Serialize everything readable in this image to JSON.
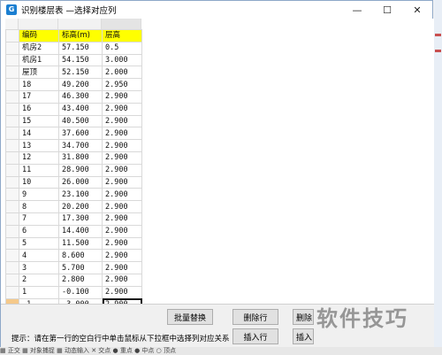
{
  "window": {
    "title": "识别楼层表 —选择对应列",
    "app_icon": "G",
    "minimize_glyph": "—",
    "maximize_glyph": "☐",
    "close_glyph": "✕"
  },
  "grid": {
    "headers": [
      "编码",
      "标高(m)",
      "层高"
    ],
    "rows": [
      [
        "机房2",
        "57.150",
        "0.5"
      ],
      [
        "机房1",
        "54.150",
        "3.000"
      ],
      [
        "屋顶",
        "52.150",
        "2.000"
      ],
      [
        "18",
        "49.200",
        "2.950"
      ],
      [
        "17",
        "46.300",
        "2.900"
      ],
      [
        "16",
        "43.400",
        "2.900"
      ],
      [
        "15",
        "40.500",
        "2.900"
      ],
      [
        "14",
        "37.600",
        "2.900"
      ],
      [
        "13",
        "34.700",
        "2.900"
      ],
      [
        "12",
        "31.800",
        "2.900"
      ],
      [
        "11",
        "28.900",
        "2.900"
      ],
      [
        "10",
        "26.000",
        "2.900"
      ],
      [
        "9",
        "23.100",
        "2.900"
      ],
      [
        "8",
        "20.200",
        "2.900"
      ],
      [
        "7",
        "17.300",
        "2.900"
      ],
      [
        "6",
        "14.400",
        "2.900"
      ],
      [
        "5",
        "11.500",
        "2.900"
      ],
      [
        "4",
        "8.600",
        "2.900"
      ],
      [
        "3",
        "5.700",
        "2.900"
      ],
      [
        "2",
        "2.800",
        "2.900"
      ],
      [
        "1",
        "-0.100",
        "2.900"
      ],
      [
        "-1",
        "-3.000",
        "2.900"
      ]
    ]
  },
  "buttons": {
    "batch_replace": "批量替换",
    "delete_row": "删除行",
    "delete_col": "删除",
    "insert_row": "插入行",
    "insert_col": "插入"
  },
  "hint": "提示：请在第一行的空白行中单击鼠标从下拉框中选择列对应关系",
  "background_toolbar": "▦ 正交 ▦ 对象捕捉 ▦ 动态输入 ✕ 交点 ● 重点 ● 中点 ○ 顶点",
  "watermark": "软件技巧"
}
